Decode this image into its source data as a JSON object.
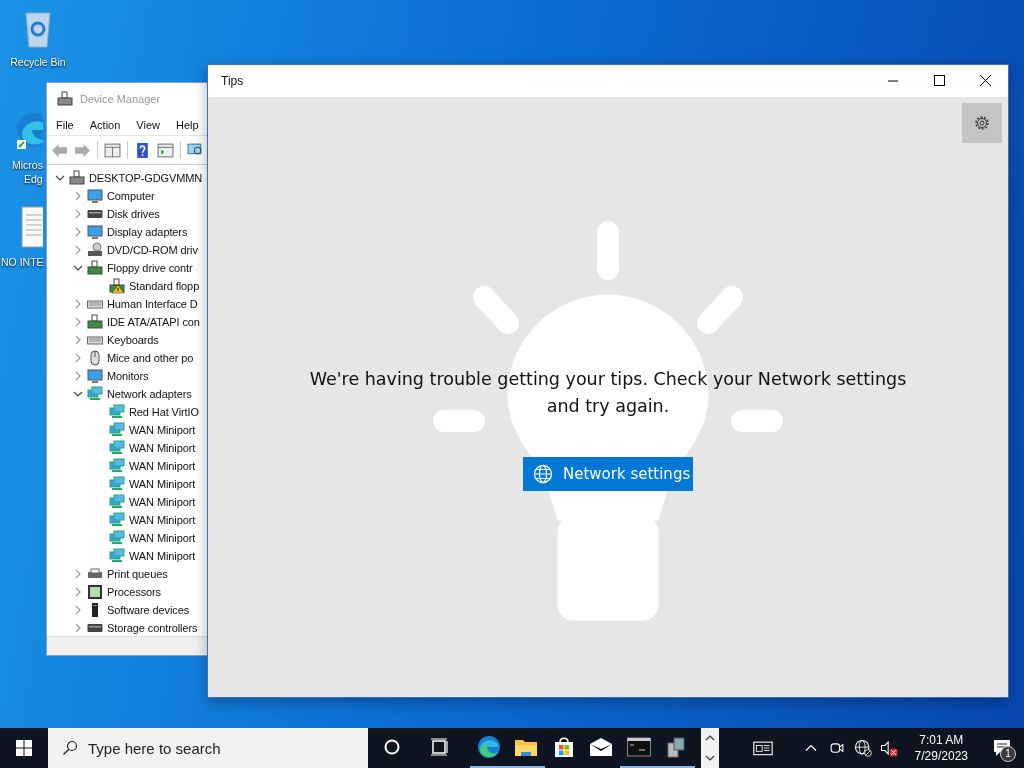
{
  "desktop_icons": [
    {
      "kind": "recycle",
      "lines": [
        "Recycle Bin"
      ]
    },
    {
      "kind": "browser",
      "lines": [
        "Micros",
        "Edg"
      ]
    },
    {
      "kind": "document",
      "lines": [
        "NO INTE"
      ]
    }
  ],
  "device_manager": {
    "title": "Device Manager",
    "menu": [
      "File",
      "Action",
      "View",
      "Help"
    ],
    "tree": {
      "label": "DESKTOP-GDGVMMN",
      "kind": "computer-root",
      "expanded": true,
      "children": [
        {
          "label": "Computer",
          "kind": "monitor",
          "expanded": false
        },
        {
          "label": "Disk drives",
          "kind": "drive",
          "expanded": false
        },
        {
          "label": "Display adapters",
          "kind": "monitor",
          "expanded": false
        },
        {
          "label": "DVD/CD-ROM driv",
          "kind": "disc",
          "expanded": false
        },
        {
          "label": "Floppy drive contr",
          "kind": "board",
          "expanded": true,
          "children": [
            {
              "label": "Standard flopp",
              "kind": "board",
              "warning": true
            }
          ]
        },
        {
          "label": "Human Interface D",
          "kind": "keyboard",
          "expanded": false
        },
        {
          "label": "IDE ATA/ATAPI con",
          "kind": "board",
          "expanded": false
        },
        {
          "label": "Keyboards",
          "kind": "keyboard",
          "expanded": false
        },
        {
          "label": "Mice and other po",
          "kind": "mouse",
          "expanded": false
        },
        {
          "label": "Monitors",
          "kind": "monitor",
          "expanded": false
        },
        {
          "label": "Network adapters",
          "kind": "network",
          "expanded": true,
          "children": [
            {
              "label": "Red Hat VirtIO",
              "kind": "network",
              "warning": false
            },
            {
              "label": "WAN Miniport",
              "kind": "network",
              "warning": false
            },
            {
              "label": "WAN Miniport",
              "kind": "network",
              "warning": false
            },
            {
              "label": "WAN Miniport",
              "kind": "network",
              "warning": false
            },
            {
              "label": "WAN Miniport",
              "kind": "network",
              "warning": false
            },
            {
              "label": "WAN Miniport",
              "kind": "network",
              "warning": false
            },
            {
              "label": "WAN Miniport",
              "kind": "network",
              "warning": false
            },
            {
              "label": "WAN Miniport",
              "kind": "network",
              "warning": false
            },
            {
              "label": "WAN Miniport",
              "kind": "network",
              "warning": false
            }
          ]
        },
        {
          "label": "Print queues",
          "kind": "printer",
          "expanded": false
        },
        {
          "label": "Processors",
          "kind": "chip",
          "expanded": false
        },
        {
          "label": "Software devices",
          "kind": "tower",
          "expanded": false
        },
        {
          "label": "Storage controllers",
          "kind": "drive",
          "expanded": false
        }
      ]
    }
  },
  "tips": {
    "title": "Tips",
    "message": "We're having trouble getting your tips. Check your Network settings and try again.",
    "button": "Network settings"
  },
  "taskbar": {
    "search": {
      "placeholder": "Type here to search"
    },
    "apps": [
      {
        "kind": "cortana",
        "running": false
      },
      {
        "kind": "taskview",
        "running": false
      },
      {
        "kind": "browser",
        "running": true
      },
      {
        "kind": "folder",
        "running": true
      },
      {
        "kind": "store",
        "running": false
      },
      {
        "kind": "mail",
        "running": false
      },
      {
        "kind": "terminal",
        "running": true
      },
      {
        "kind": "devices",
        "running": true
      }
    ],
    "tray": [
      {
        "kind": "news"
      },
      {
        "kind": "chevron"
      },
      {
        "kind": "camera"
      },
      {
        "kind": "globe"
      },
      {
        "kind": "speaker",
        "muted": true
      }
    ],
    "time": "7:01 AM",
    "date": "7/29/2023",
    "notifications": "1"
  }
}
